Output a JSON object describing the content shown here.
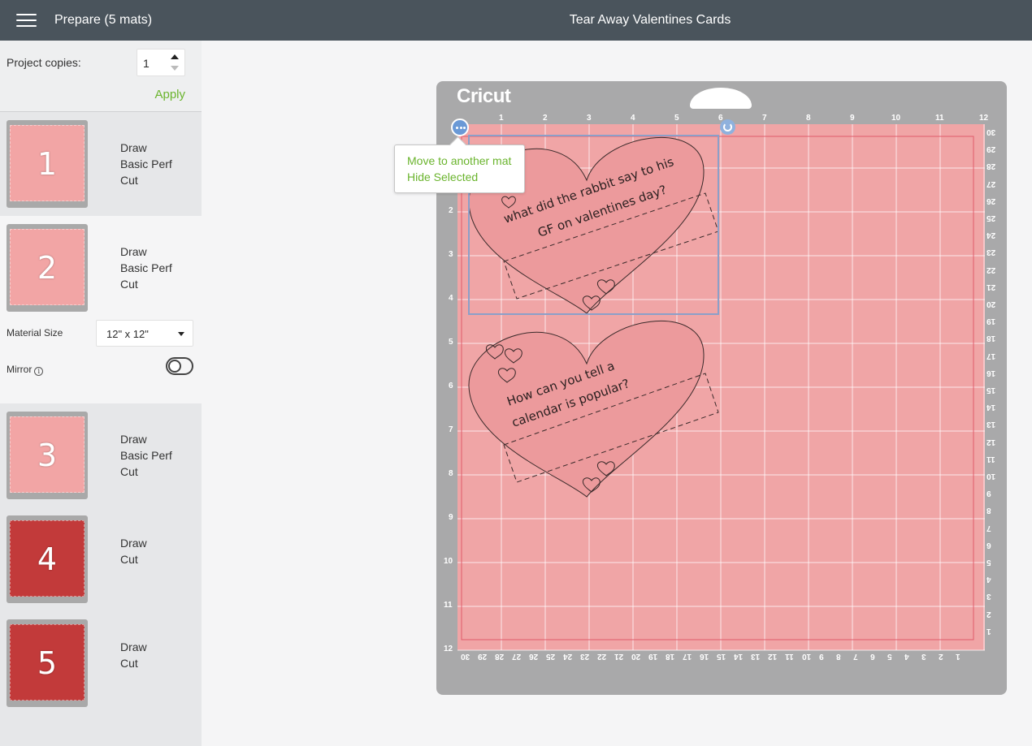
{
  "header": {
    "mode_title": "Prepare (5 mats)",
    "project_title": "Tear Away Valentines Cards"
  },
  "sidebar": {
    "copies_label": "Project copies:",
    "copies_value": "1",
    "apply_label": "Apply",
    "mats": [
      {
        "number": "1",
        "ops": [
          "Draw",
          "Basic Perf",
          "Cut"
        ],
        "color": "#f2a5a5"
      },
      {
        "number": "2",
        "ops": [
          "Draw",
          "Basic Perf",
          "Cut"
        ],
        "color": "#f2a5a5"
      },
      {
        "number": "3",
        "ops": [
          "Draw",
          "Basic Perf",
          "Cut"
        ],
        "color": "#f2a5a5"
      },
      {
        "number": "4",
        "ops": [
          "Draw",
          "Cut"
        ],
        "color": "#c23a3a"
      },
      {
        "number": "5",
        "ops": [
          "Draw",
          "Cut"
        ],
        "color": "#c23a3a"
      }
    ],
    "material_size_label": "Material Size",
    "material_size_value": "12\" x 12\"",
    "mirror_label": "Mirror",
    "mirror_info": "i"
  },
  "canvas": {
    "logo": "Cricut",
    "top_ruler": [
      "1",
      "2",
      "3",
      "4",
      "5",
      "6",
      "7",
      "8",
      "9",
      "10",
      "11",
      "12"
    ],
    "left_ruler": [
      "2",
      "3",
      "4",
      "5",
      "6",
      "7",
      "8",
      "9",
      "10",
      "11",
      "12"
    ],
    "right_ruler": [
      "30",
      "29",
      "28",
      "27",
      "26",
      "25",
      "24",
      "23",
      "22",
      "21",
      "20",
      "19",
      "18",
      "17",
      "16",
      "15",
      "14",
      "13",
      "12",
      "11",
      "10",
      "9",
      "8",
      "7",
      "6",
      "5",
      "4",
      "3",
      "2",
      "1"
    ],
    "bottom_ruler": [
      "30",
      "29",
      "28",
      "27",
      "26",
      "25",
      "24",
      "23",
      "22",
      "21",
      "20",
      "19",
      "18",
      "17",
      "16",
      "15",
      "14",
      "13",
      "12",
      "11",
      "10",
      "9",
      "8",
      "7",
      "6",
      "5",
      "4",
      "3",
      "2",
      "1"
    ],
    "card1_text": [
      "what did the rabbit say to his",
      "GF on valentines day?"
    ],
    "card2_text": [
      "How can you tell a",
      "calendar is popular?"
    ],
    "context_menu": {
      "items": [
        "Move to another mat",
        "Hide Selected"
      ]
    },
    "colors": {
      "mat_pink": "#f0a5a6",
      "heart_fill": "#ec9a9c",
      "selection": "#8c9fc8",
      "accent_green": "#6ab42d"
    }
  }
}
